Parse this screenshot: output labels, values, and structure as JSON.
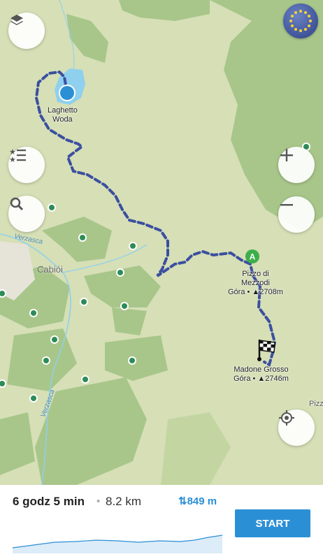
{
  "map": {
    "lake_label_1": "Laghetto",
    "lake_label_2": "Woda",
    "peak_a_name_1": "Pizzo di",
    "peak_a_name_2": "Mezzodi",
    "peak_a_detail": "Góra • ▲2708m",
    "peak_a_marker": "A",
    "peak_b_name": "Madone Grosso",
    "peak_b_detail": "Góra • ▲2746m",
    "place_name": "Cabiói",
    "river_1": "Verzasca",
    "river_2": "Verzasca",
    "edge_label": "Pizz",
    "colors": {
      "route": "#3b4fa0",
      "forest": "#a8c68a",
      "meadow": "#d6dfb6",
      "water": "#8ed0ee",
      "accent": "#2b8fd6"
    }
  },
  "controls": {
    "layers_icon": "layers-icon",
    "favorites_icon": "favorites-list-icon",
    "search_icon": "search-icon",
    "zoom_in_icon": "plus-icon",
    "zoom_out_icon": "minus-icon",
    "locate_icon": "crosshair-icon",
    "globe_icon": "eu-globe-icon"
  },
  "route_summary": {
    "duration": "6 godz 5 min",
    "separator": "•",
    "distance": "8.2 km",
    "elevation_gain": "⇅849 m",
    "start_label": "START"
  }
}
